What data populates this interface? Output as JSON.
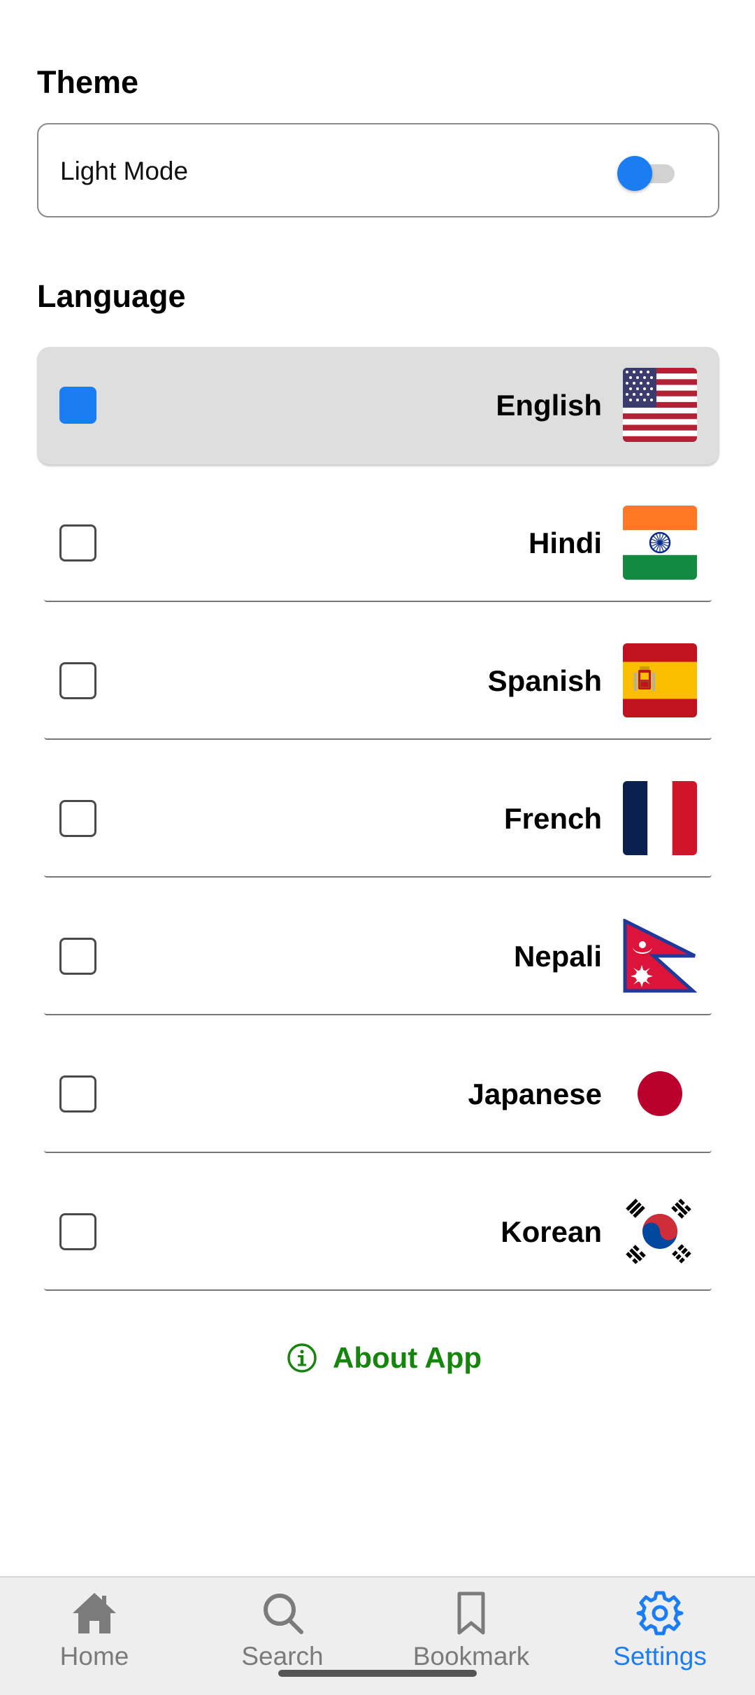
{
  "theme": {
    "title": "Theme",
    "mode_label": "Light Mode",
    "toggle_on": true
  },
  "language": {
    "title": "Language",
    "options": [
      {
        "label": "English",
        "flag": "us-flag",
        "checked": true
      },
      {
        "label": "Hindi",
        "flag": "india-flag",
        "checked": false
      },
      {
        "label": "Spanish",
        "flag": "spain-flag",
        "checked": false
      },
      {
        "label": "French",
        "flag": "france-flag",
        "checked": false
      },
      {
        "label": "Nepali",
        "flag": "nepal-flag",
        "checked": false
      },
      {
        "label": "Japanese",
        "flag": "japan-flag",
        "checked": false
      },
      {
        "label": "Korean",
        "flag": "korea-flag",
        "checked": false
      }
    ]
  },
  "about": {
    "label": "About App",
    "icon": "info-icon"
  },
  "nav": {
    "items": [
      {
        "label": "Home",
        "icon": "home-icon",
        "active": false
      },
      {
        "label": "Search",
        "icon": "search-icon",
        "active": false
      },
      {
        "label": "Bookmark",
        "icon": "bookmark-icon",
        "active": false
      },
      {
        "label": "Settings",
        "icon": "gear-icon",
        "active": true
      }
    ]
  },
  "colors": {
    "accent": "#1a7df2",
    "about_green": "#16850e",
    "selected_row": "#dedede",
    "nav_bg": "#eeeeee",
    "nav_inactive": "#7b7b7b"
  }
}
